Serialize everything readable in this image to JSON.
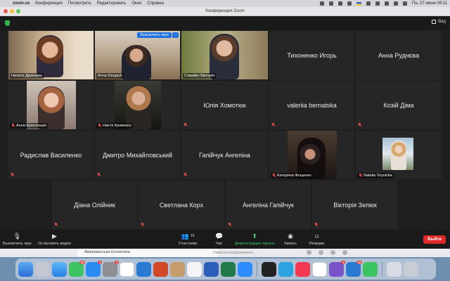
{
  "menubar": {
    "app": "zoom.us",
    "items": [
      "Конференция",
      "Посмотреть",
      "Редактировать",
      "Окно",
      "Справка"
    ],
    "clock": "Пн, 27 июня  09:11"
  },
  "window": {
    "title": "Конференция Zoom",
    "view_label": "Вид"
  },
  "tiles": {
    "t1": "Наталя Драгнева",
    "t2": "Anna Dergach",
    "t2_unmute": "Выключить звук",
    "t2_more": "···",
    "t3": "Совайко Вікторія",
    "t4": "Тихоненко Игорь",
    "t5": "Анна Руднєва",
    "t6": "Анна Красношап",
    "t7": "Настя Кривенко",
    "t8": "Юлія Хомотюк",
    "t9": "valeriia bernatska",
    "t10": "Козій Діма",
    "t11": "Радислав Василенко",
    "t12": "Дмитро Михайловський",
    "t13": "Гапійчук Ангеліна",
    "t14": "Катерина Фещенко",
    "t15": "Natalia Voynicka",
    "t16": "Діана Олійник",
    "t17": "Светлана Корх",
    "t18": "Ангеліна Гапійчук",
    "t19": "Вікторія Зелюк"
  },
  "toolbar": {
    "mute": "Выключить звук",
    "video": "Остановить видео",
    "participants": "Участники",
    "participants_count": "19",
    "chat": "Чат",
    "share": "Демонстрация экрана",
    "record": "Запись",
    "reactions": "Реакции",
    "leave": "Выйти"
  },
  "behind": {
    "chat_name": "Американська Косметика",
    "msg_placeholder": "Написати повідомлення..."
  },
  "dock": {
    "badges": {
      "messages": "10",
      "appstore": "1",
      "prefs": "1",
      "viber": "1",
      "zoom_mail": "16"
    }
  },
  "colors": {
    "active_speaker": "#d8e34c",
    "share_green": "#3ac86a",
    "leave_red": "#e02828",
    "mute_red": "#e34848",
    "unmute_blue": "#1e6fe0"
  }
}
